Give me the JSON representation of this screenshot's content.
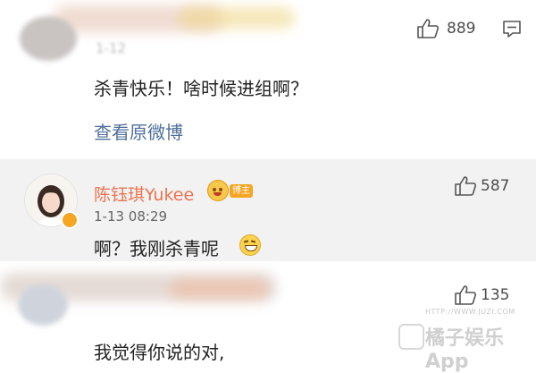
{
  "comment1": {
    "time": "1-12",
    "likes": "889",
    "text": "杀青快乐！啥时候进组啊？",
    "view_original": "查看原微博"
  },
  "reply": {
    "username": "陈钰琪Yukee",
    "badge": "博主",
    "time": "1-13 08:29",
    "likes": "587",
    "text": "啊？我刚杀青呢"
  },
  "comment2": {
    "likes": "135",
    "text": "我觉得你说的对,"
  },
  "watermark": {
    "main": "橘子娱乐App",
    "url": "HTTP://WWW.JUZI.COM"
  },
  "colors": {
    "username": "#eb7350",
    "link": "#4e6f9a",
    "reply_bg": "#f2f2f2"
  }
}
